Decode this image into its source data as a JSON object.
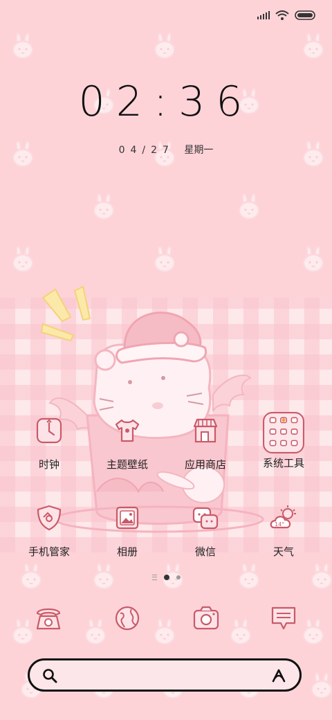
{
  "status_bar": {
    "icons": [
      "signal-icon",
      "wifi-icon",
      "battery-icon"
    ]
  },
  "lockscreen": {
    "time": "02:36",
    "date": "04/27",
    "weekday": "星期一"
  },
  "apps": [
    {
      "label": "时钟",
      "icon": "clock-icon"
    },
    {
      "label": "主题壁纸",
      "icon": "tshirt-icon"
    },
    {
      "label": "应用商店",
      "icon": "store-icon"
    },
    {
      "label": "系统工具",
      "icon": "folder-icon"
    },
    {
      "label": "手机管家",
      "icon": "shield-icon"
    },
    {
      "label": "相册",
      "icon": "gallery-icon"
    },
    {
      "label": "微信",
      "icon": "wechat-icon"
    },
    {
      "label": "天气",
      "icon": "weather-icon",
      "badge": "14°"
    }
  ],
  "page_indicator": {
    "pages": 2,
    "active": 1
  },
  "dock": [
    {
      "icon": "phone-icon"
    },
    {
      "icon": "browser-globe-icon"
    },
    {
      "icon": "camera-icon"
    },
    {
      "icon": "message-icon"
    }
  ],
  "search": {
    "icons": [
      "search-icon",
      "assistant-icon"
    ]
  },
  "colors": {
    "background": "#fdd3d8",
    "accent": "#d96a78",
    "icon_stroke": "#c95a68"
  }
}
